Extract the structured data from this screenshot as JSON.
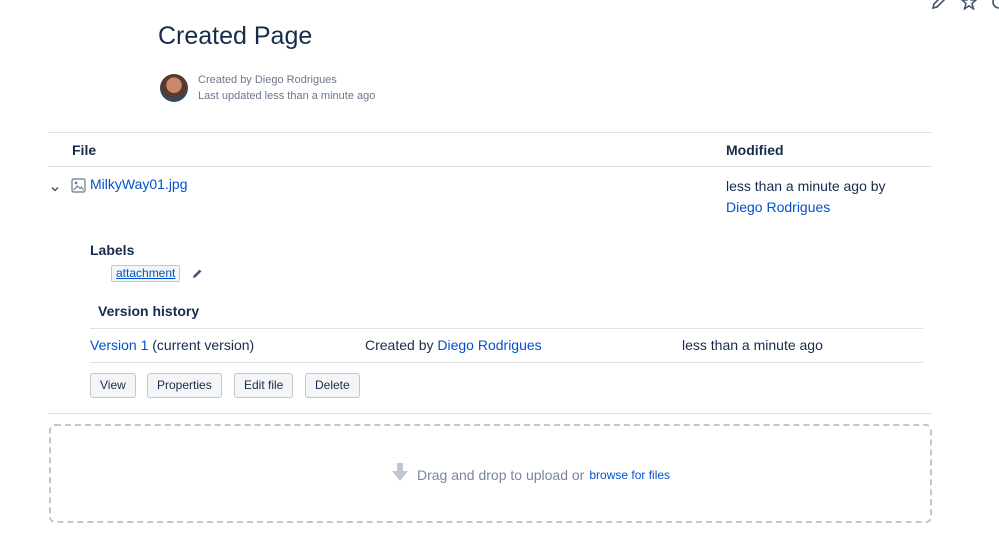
{
  "top_icons": [
    "edit-icon",
    "star-icon",
    "watch-icon"
  ],
  "page": {
    "title": "Created Page",
    "created_by": "Created by Diego Rodrigues",
    "last_updated": "Last updated less than a minute ago"
  },
  "table": {
    "headers": {
      "file": "File",
      "modified": "Modified"
    },
    "row": {
      "file_name": "MilkyWay01.jpg",
      "modified_text": "less than a minute ago by",
      "modified_user": "Diego Rodrigues"
    }
  },
  "labels": {
    "heading": "Labels",
    "items": [
      "attachment"
    ]
  },
  "version_history": {
    "heading": "Version history",
    "rows": [
      {
        "version": "Version 1",
        "status": "(current version)",
        "created_prefix": "Created by",
        "created_by": "Diego Rodrigues",
        "when": "less than a minute ago"
      }
    ]
  },
  "actions": [
    "View",
    "Properties",
    "Edit file",
    "Delete"
  ],
  "dropzone": {
    "text": "Drag and drop to upload or",
    "link": "browse for files"
  },
  "colors": {
    "link": "#0052cc",
    "text": "#172b4d",
    "muted": "#6b778c",
    "border": "#dfe1e6"
  }
}
